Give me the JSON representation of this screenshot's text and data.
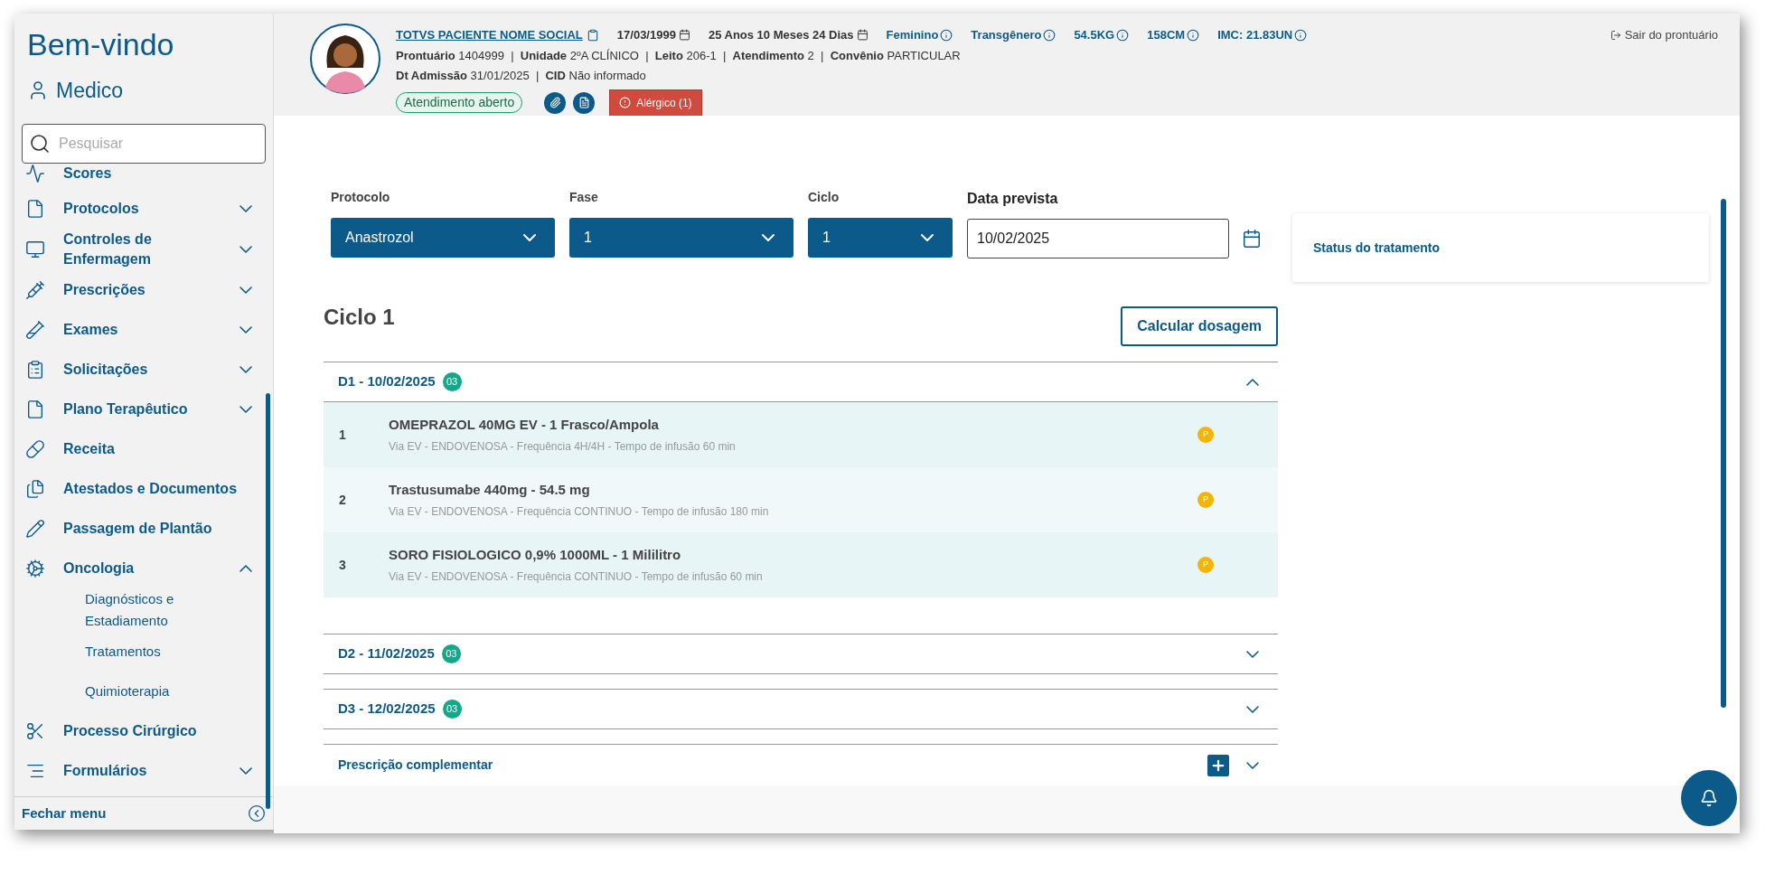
{
  "sidebar": {
    "title": "Bem-vindo",
    "user": "Medico",
    "search": {
      "placeholder": "Pesquisar"
    },
    "items": [
      {
        "label": "Scores",
        "kind": "link"
      },
      {
        "label": "Protocolos",
        "kind": "group",
        "expanded": false
      },
      {
        "label": "Controles de Enfermagem",
        "kind": "group",
        "expanded": false
      },
      {
        "label": "Prescrições",
        "kind": "group",
        "expanded": false
      },
      {
        "label": "Exames",
        "kind": "group",
        "expanded": false
      },
      {
        "label": "Solicitações",
        "kind": "group",
        "expanded": false
      },
      {
        "label": "Plano Terapêutico",
        "kind": "group",
        "expanded": false
      },
      {
        "label": "Receita",
        "kind": "link"
      },
      {
        "label": "Atestados e Documentos",
        "kind": "link"
      },
      {
        "label": "Passagem de Plantão",
        "kind": "link"
      },
      {
        "label": "Oncologia",
        "kind": "group",
        "expanded": true,
        "children": [
          {
            "label": "Diagnósticos e Estadiamento"
          },
          {
            "label": "Tratamentos"
          },
          {
            "label": "Quimioterapia"
          }
        ]
      },
      {
        "label": "Processo Cirúrgico",
        "kind": "link"
      },
      {
        "label": "Formulários",
        "kind": "group",
        "expanded": false
      }
    ],
    "collapse": "Fechar menu"
  },
  "patient": {
    "name": "TOTVS PACIENTE NOME SOCIAL",
    "birth_date": "17/03/1999",
    "age": "25 Anos 10 Meses 24 Dias",
    "info": [
      "Feminino",
      "Transgênero",
      "54.5KG",
      "158CM",
      "IMC: 21.83UN"
    ],
    "line_2": "**Prontuário** 1404999  |  **Unidade** 2ºA CLÍNICO  |  **Leito** 206-1  |  **Atendimento** 2  |  **Convênio** PARTICULAR",
    "line_3": "**Dt Admissão** 31/01/2025  |  **CID** Não informado",
    "status": "Atendimento aberto",
    "alert": "Alérgico (1)",
    "exit": "Sair do prontuário"
  },
  "form": {
    "protocolo": {
      "label": "Protocolo",
      "value": "Anastrozol"
    },
    "fase": {
      "label": "Fase",
      "value": "1"
    },
    "ciclo": {
      "label": "Ciclo",
      "value": "1"
    },
    "data_prevista": {
      "label": "Data prevista",
      "value": "10/02/2025"
    }
  },
  "cycle": {
    "title": "Ciclo 1",
    "action": "Calcular dosagem",
    "days": [
      {
        "title": "D1 - 10/02/2025",
        "count": "03",
        "expanded": true,
        "items": [
          {
            "number": "1",
            "name": "OMEPRAZOL 40MG EV - 1 Frasco/Ampola",
            "details": "Via EV - ENDOVENOSA - Frequência 4H/4H - Tempo de infusão 60 min",
            "status": "P"
          },
          {
            "number": "2",
            "name": "Trastusumabe 440mg - 54.5 mg",
            "details": "Via EV - ENDOVENOSA - Frequência CONTINUO - Tempo de infusão 180 min",
            "status": "P"
          },
          {
            "number": "3",
            "name": "SORO FISIOLOGICO 0,9% 1000ML - 1 Mililitro",
            "details": "Via EV - ENDOVENOSA - Frequência CONTINUO - Tempo de infusão 60 min",
            "status": "P"
          }
        ]
      },
      {
        "title": "D2 - 11/02/2025",
        "count": "03",
        "expanded": false
      },
      {
        "title": "D3 - 12/02/2025",
        "count": "03",
        "expanded": false
      }
    ],
    "complementary": {
      "title": "Prescrição complementar",
      "expanded": false
    }
  },
  "status_panel": {
    "title": "Status do tratamento"
  }
}
